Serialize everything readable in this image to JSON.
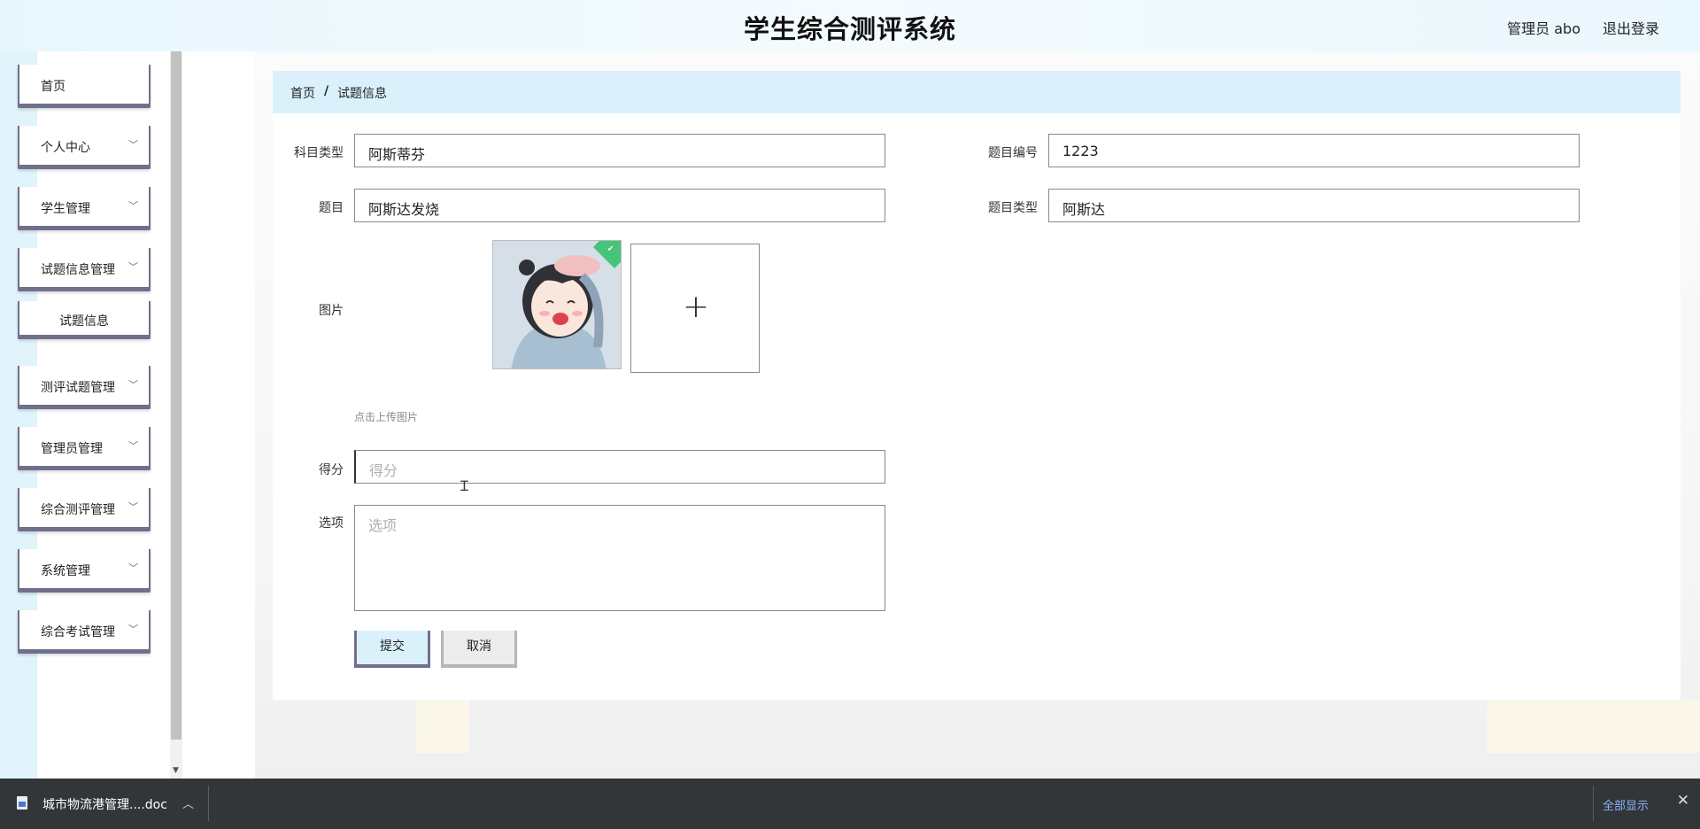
{
  "header": {
    "title": "学生综合测评系统",
    "user": "管理员 abo",
    "logout": "退出登录"
  },
  "sidebar": {
    "items": [
      {
        "label": "首页",
        "has_children": false
      },
      {
        "label": "个人中心",
        "has_children": true
      },
      {
        "label": "学生管理",
        "has_children": true
      },
      {
        "label": "试题信息管理",
        "has_children": true
      },
      {
        "label": "试题信息",
        "is_sub": true
      },
      {
        "label": "测评试题管理",
        "has_children": true
      },
      {
        "label": "管理员管理",
        "has_children": true
      },
      {
        "label": "综合测评管理",
        "has_children": true
      },
      {
        "label": "系统管理",
        "has_children": true
      },
      {
        "label": "综合考试管理",
        "has_children": true
      }
    ]
  },
  "breadcrumb": {
    "home": "首页",
    "separator": "/",
    "current": "试题信息"
  },
  "form": {
    "subject_type": {
      "label": "科目类型",
      "value": "阿斯蒂芬"
    },
    "question_no": {
      "label": "题目编号",
      "value": "1223"
    },
    "question": {
      "label": "题目",
      "value": "阿斯达发烧"
    },
    "question_type": {
      "label": "题目类型",
      "value": "阿斯达"
    },
    "image": {
      "label": "图片",
      "upload_hint": "点击上传图片",
      "add_icon": "+"
    },
    "score": {
      "label": "得分",
      "placeholder": "得分"
    },
    "options": {
      "label": "选项",
      "placeholder": "选项"
    },
    "submit": "提交",
    "cancel": "取消"
  },
  "download_bar": {
    "filename": "城市物流港管理....doc",
    "show_all": "全部显示"
  },
  "colors": {
    "accent_light": "#daf1fc",
    "menu_border": "#70708c",
    "shelf_bg": "#323639"
  }
}
